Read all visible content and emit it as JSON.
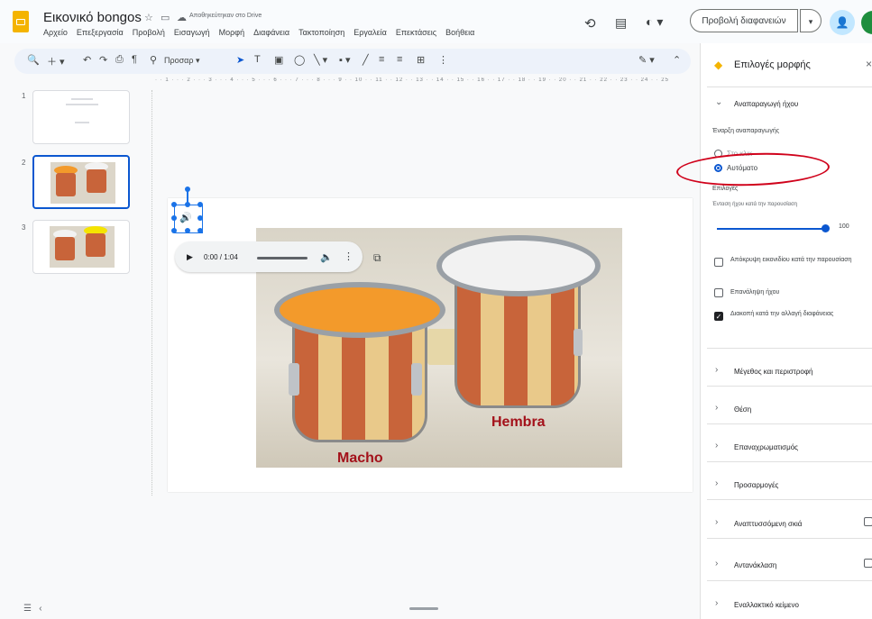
{
  "window": {
    "doc_title": "Εικονικό bongos",
    "saved_status": "Αποθηκεύτηκαν στο Drive"
  },
  "menu": [
    "Αρχείο",
    "Επεξεργασία",
    "Προβολή",
    "Εισαγωγή",
    "Μορφή",
    "Διαφάνεια",
    "Τακτοποίηση",
    "Εργαλεία",
    "Επεκτάσεις",
    "Βοήθεια"
  ],
  "header_actions": {
    "slideshow_label": "Προβολή διαφανειών",
    "slideshow_arrow": "▾"
  },
  "toolbar": {
    "zoom_label": "Προσαρ ▾"
  },
  "filmstrip": {
    "slides": [
      {
        "number": "1"
      },
      {
        "number": "2",
        "active": true
      },
      {
        "number": "3"
      }
    ]
  },
  "ruler_text": "· · 1 · · · 2 · · · 3 · · · 4 · · · 5 · · · 6 · · · 7 · · · 8 · · · 9 · · 10 · · 11 · · 12 · · 13 · · 14 · · 15 · · 16 · · 17 · · 18 · · 19 · · 20 · · 21 · · 22 · · 23 · · 24 · · 25",
  "audio_player": {
    "time": "0:00 / 1:04"
  },
  "slide_image": {
    "label_left": "Macho",
    "label_right": "Hembra",
    "head_left_color": "#f39a2b",
    "head_right_color": "#f2f2f2"
  },
  "format_panel": {
    "title": "Επιλογές μορφής",
    "section_playback": "Αναπαραγωγή ήχου",
    "start_label": "Έναρξη αναπαραγωγής",
    "option_click": "Στο κλικ",
    "option_auto": "Αυτόματο",
    "options_label": "Επιλογές",
    "volume_label": "Ένταση ήχου κατά την παρουσίαση",
    "volume_value": "100",
    "hide_icon": "Απόκρυψη εικονιδίου κατά την παρουσίαση",
    "loop": "Επανάληψη ήχου",
    "stop_on_change": "Διακοπή κατά την αλλαγή διαφάνειας",
    "stop_checked": true,
    "sections": [
      "Μέγεθος και περιστροφή",
      "Θέση",
      "Επαναχρωματισμός",
      "Προσαρμογές",
      "Αναπτυσσόμενη σκιά",
      "Αντανάκλαση",
      "Εναλλακτικό κείμενο"
    ]
  },
  "colors": {
    "accent": "#0b57d0",
    "annotation": "#d0021b",
    "label_red": "#a3111a"
  }
}
